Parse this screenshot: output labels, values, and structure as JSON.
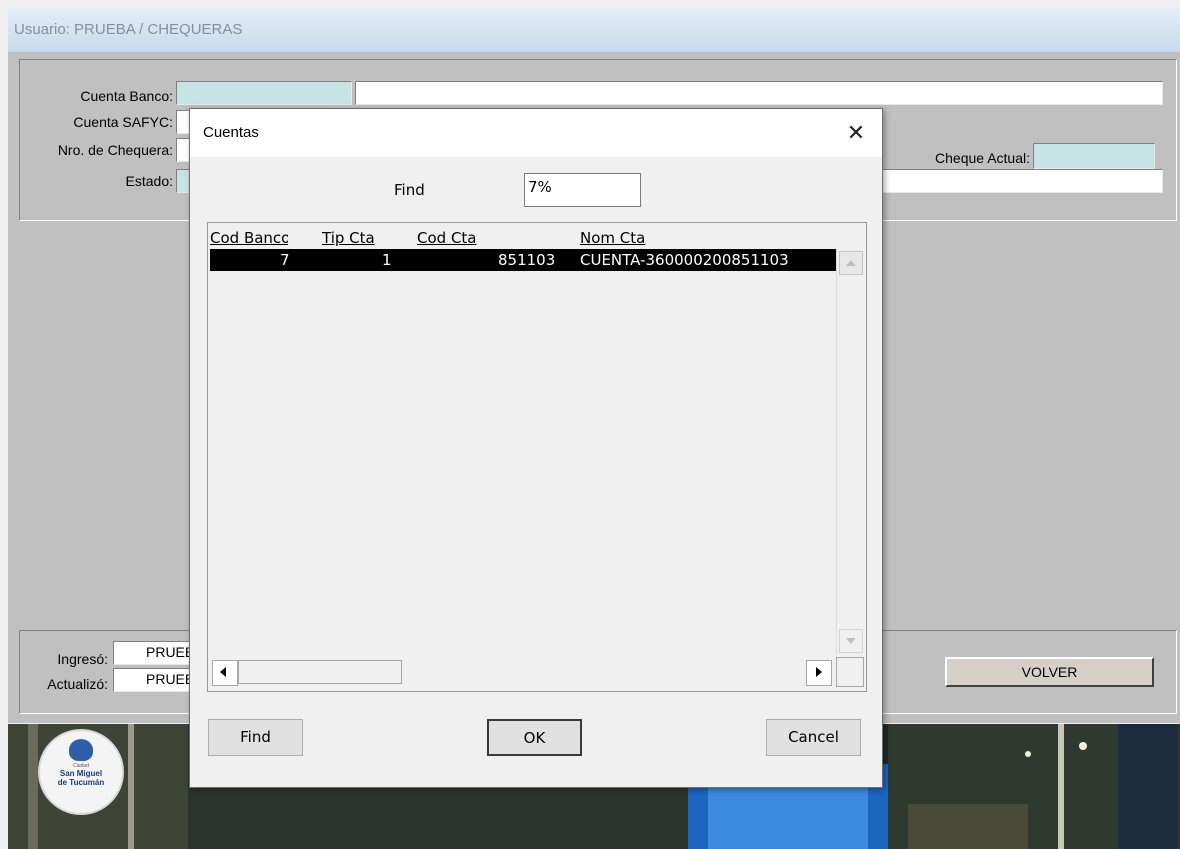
{
  "window": {
    "title": "Usuario: PRUEBA  /  CHEQUERAS"
  },
  "form": {
    "cuenta_banco_label": "Cuenta Banco:",
    "cuenta_safyc_label": "Cuenta SAFYC:",
    "nro_chequera_label": "Nro. de Chequera:",
    "estado_label": "Estado:",
    "cheque_actual_label": "Cheque Actual:",
    "cuenta_banco_value": "",
    "cuenta_banco_desc": "",
    "cheque_actual_value": ""
  },
  "footer": {
    "ingreso_label": "Ingresó:",
    "ingreso_value": "PRUEBA",
    "actualizo_label": "Actualizó:",
    "actualizo_value": "PRUEBA",
    "volver_label": "VOLVER"
  },
  "logo": {
    "line1": "Ciudad",
    "line2": "San Miguel",
    "line3": "de Tucumán"
  },
  "dialog": {
    "title": "Cuentas",
    "close_glyph": "✕",
    "find_label": "Find",
    "find_value": "7%",
    "columns": [
      "Cod Banco",
      "Tip Cta",
      "Cod Cta",
      "Nom Cta"
    ],
    "rows": [
      {
        "cod_banco": "7",
        "tip_cta": "1",
        "cod_cta": "851103",
        "nom_cta": "CUENTA-360000200851103"
      }
    ],
    "find_button": "Find",
    "ok_button": "OK",
    "cancel_button": "Cancel"
  },
  "colors": {
    "client_bg": "#c0c0c0",
    "field_cyan": "#c6e4e6",
    "selection": "#000000"
  }
}
